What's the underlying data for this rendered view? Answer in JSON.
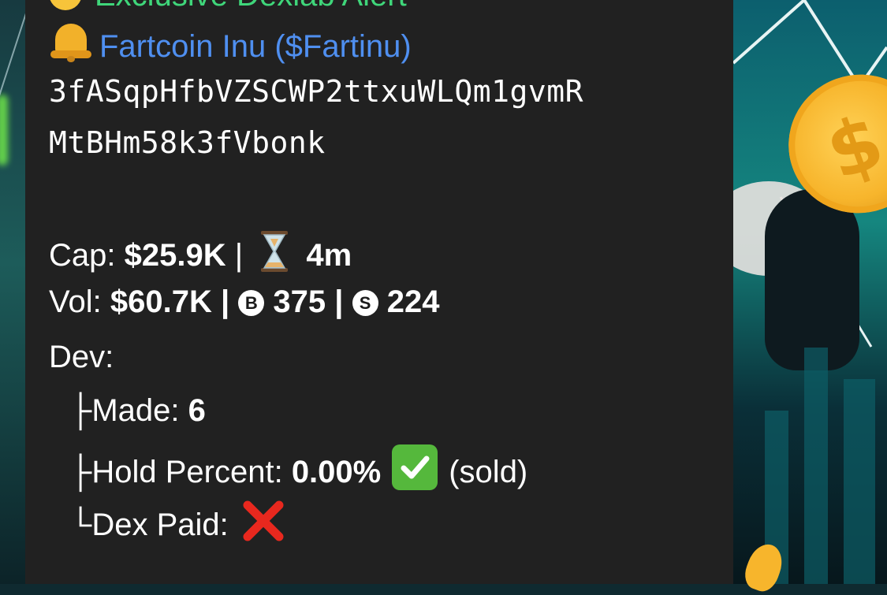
{
  "alert_title": "Exclusive Dexlab Alert",
  "token": {
    "name": "Fartcoin Inu ($Fartinu)",
    "address_line1": "3fASqpHfbVZSCWP2ttxuWLQm1gvmR",
    "address_line2": "MtBHm58k3fVbonk"
  },
  "stats": {
    "cap_label": "Cap:",
    "cap_value": "$25.9K",
    "age_value": "4m",
    "vol_label": "Vol:",
    "vol_value": "$60.7K",
    "buys_icon": "B",
    "buys_value": "375",
    "sells_icon": "S",
    "sells_value": "224",
    "separator": "|"
  },
  "dev": {
    "label": "Dev:",
    "made_prefix": "├",
    "made_label": "Made:",
    "made_value": "6",
    "hold_prefix": "├",
    "hold_label": "Hold Percent:",
    "hold_value": "0.00%",
    "hold_note": "(sold)",
    "dex_prefix": "└",
    "dex_label": "Dex Paid:"
  },
  "icons": {
    "bell": "bell-icon",
    "hourglass": "hourglass-icon",
    "check": "check-mark-icon",
    "cross": "cross-mark-icon"
  },
  "colors": {
    "bubble_bg": "#212121",
    "title_green": "#3fd67a",
    "link_blue": "#4f8ff0",
    "text": "#ffffff"
  }
}
